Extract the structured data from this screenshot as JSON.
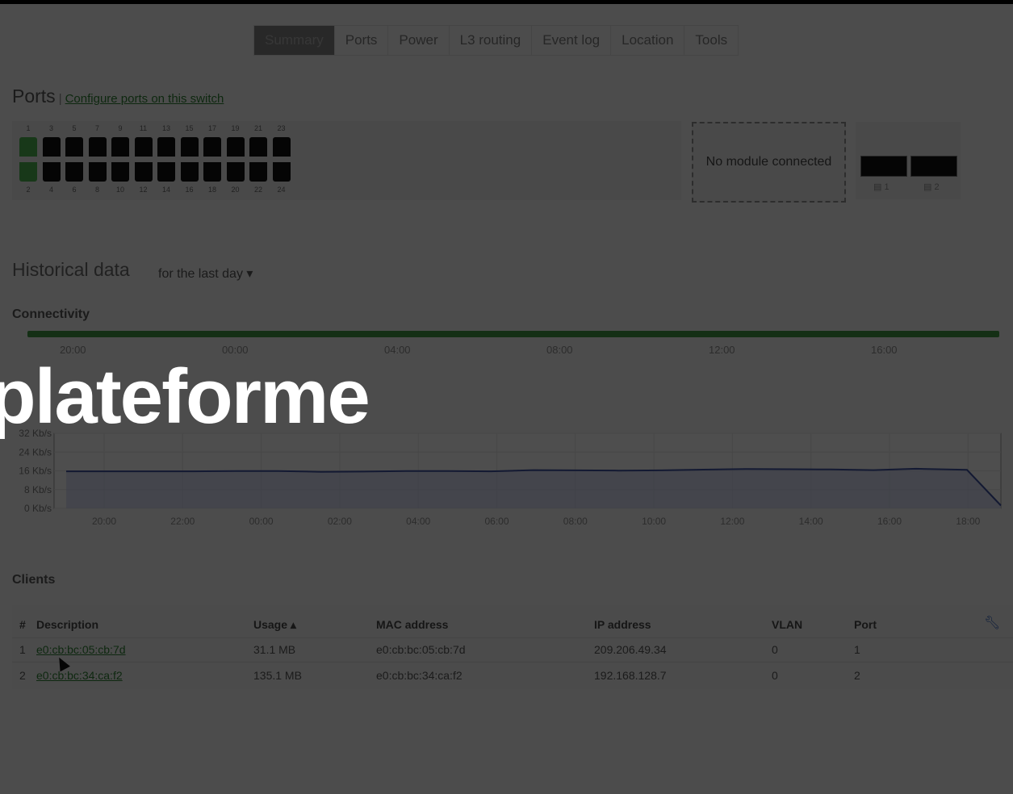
{
  "tabs": [
    "Summary",
    "Ports",
    "Power",
    "L3 routing",
    "Event log",
    "Location",
    "Tools"
  ],
  "active_tab": "Summary",
  "ports_section": {
    "title": "Ports",
    "separator": "|",
    "configure_link": "Configure ports on this switch",
    "top_numbers": [
      "1",
      "3",
      "5",
      "7",
      "9",
      "11",
      "13",
      "15",
      "17",
      "19",
      "21",
      "23"
    ],
    "bottom_numbers": [
      "2",
      "4",
      "6",
      "8",
      "10",
      "12",
      "14",
      "16",
      "18",
      "20",
      "22",
      "24"
    ],
    "port_up": [
      "1",
      "2"
    ],
    "module_text": "No module connected",
    "sfp_labels": [
      "1",
      "2"
    ]
  },
  "historical": {
    "title": "Historical data",
    "range": "for the last day ▾"
  },
  "connectivity": {
    "title": "Connectivity",
    "ticks": [
      "20:00",
      "00:00",
      "04:00",
      "08:00",
      "12:00",
      "16:00"
    ],
    "status_color": "#3f9142"
  },
  "overlay": {
    "text": "plateforme"
  },
  "chart_data": {
    "type": "area",
    "x": [
      "20:00",
      "22:00",
      "00:00",
      "02:00",
      "04:00",
      "06:00",
      "08:00",
      "10:00",
      "12:00",
      "14:00",
      "16:00",
      "18:00"
    ],
    "y_ticks": [
      "0 Kb/s",
      "8 Kb/s",
      "16 Kb/s",
      "24 Kb/s",
      "32 Kb/s"
    ],
    "ylim": [
      0,
      32
    ],
    "series": [
      {
        "values": [
          15.8,
          15.8,
          15.8,
          15.8,
          15.9,
          15.9,
          15.6,
          15.7,
          15.9,
          15.9,
          15.8,
          16.3,
          16.2,
          16.1,
          16.2,
          16.5,
          16.8,
          16.7,
          16.6,
          16.3,
          16.9,
          16.4,
          1.2
        ]
      }
    ],
    "line_color": "#3c4f9c",
    "fill_color": "#bcc5e6"
  },
  "clients": {
    "title": "Clients",
    "columns": [
      "#",
      "Description",
      "Usage ▴",
      "MAC address",
      "IP address",
      "VLAN",
      "Port"
    ],
    "rows": [
      [
        "1",
        "e0:cb:bc:05:cb:7d",
        "31.1 MB",
        "e0:cb:bc:05:cb:7d",
        "209.206.49.34",
        "0",
        "1"
      ],
      [
        "2",
        "e0:cb:bc:34:ca:f2",
        "135.1 MB",
        "e0:cb:bc:34:ca:f2",
        "192.168.128.7",
        "0",
        "2"
      ]
    ]
  }
}
